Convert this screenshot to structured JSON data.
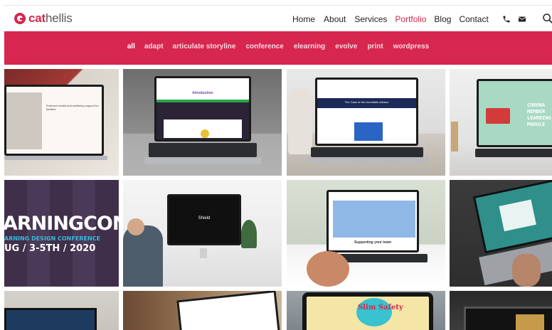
{
  "brand": {
    "logo_prefix": "cat",
    "logo_suffix": "hellis",
    "accent": "#d7264f"
  },
  "nav": {
    "items": [
      "Home",
      "About",
      "Services",
      "Portfolio",
      "Blog",
      "Contact"
    ],
    "active": "Portfolio"
  },
  "filters": {
    "items": [
      "all",
      "adapt",
      "articulate storyline",
      "conference",
      "elearning",
      "evolve",
      "print",
      "wordpress"
    ],
    "active": "all"
  },
  "tiles": {
    "t1_screen": "Embrace health and wellbeing support for families",
    "t2_screen": "Introduction",
    "t3_screen": "The Case of the Unreliable Advisor",
    "t4_screen": "CORONA MEMBER LEARNING MODULE",
    "t5_line1": "ARNINGCON",
    "t5_line2": "ARNING DESIGN CONFERENCE",
    "t5_line3": "UG / 3-5TH / 2020",
    "t6_screen": "Shield",
    "t7_screen": "Supporting your team",
    "t11_screen": "Slim Safety"
  }
}
